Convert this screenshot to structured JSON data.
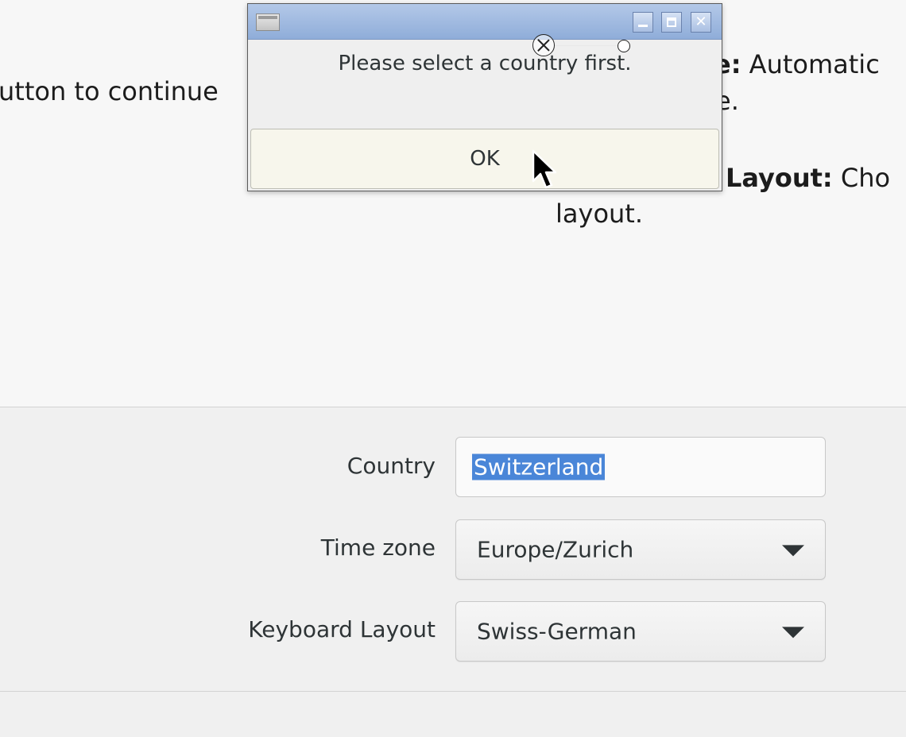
{
  "background": {
    "line1_prefix": "utton to continue",
    "line2_bold": "e:",
    "line2_text": " Automatic",
    "line3_fragment": "e.",
    "line4_bold": "Layout:",
    "line4_text": " Cho",
    "line5_text": "layout."
  },
  "dialog": {
    "message": "Please select a country first.",
    "ok_label": "OK",
    "close_glyph": "✕"
  },
  "form": {
    "country_label": "Country",
    "country_value": "Switzerland",
    "timezone_label": "Time zone",
    "timezone_value": "Europe/Zurich",
    "keyboard_label": "Keyboard Layout",
    "keyboard_value": "Swiss-German"
  },
  "colors": {
    "selection": "#4a86d8",
    "titlebar": "#9fb9e0",
    "ok_button_bg": "#f7f6ec"
  },
  "icons": [
    "window-icon",
    "minimize-icon",
    "maximize-icon",
    "close-icon",
    "dropdown-arrow-icon",
    "mouse-cursor-icon",
    "selection-handle-icon"
  ]
}
